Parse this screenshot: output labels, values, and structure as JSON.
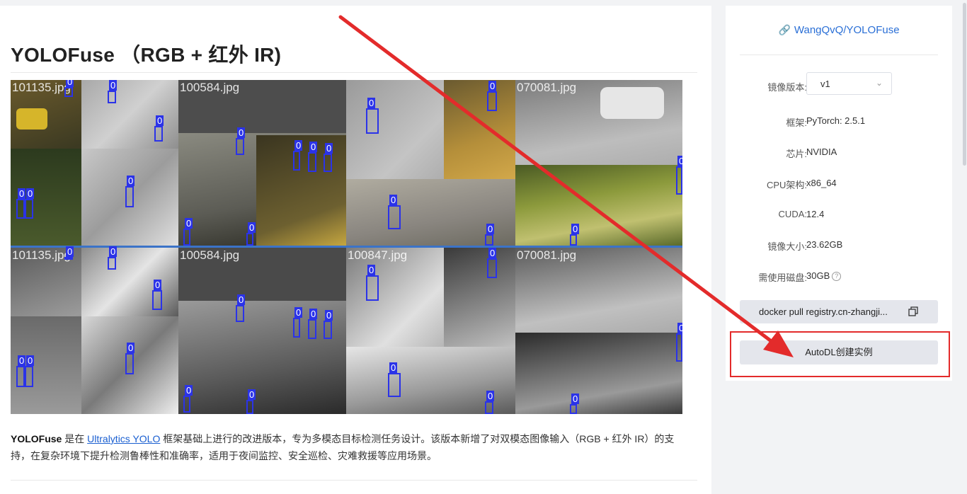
{
  "main": {
    "title": "YOLOFuse （RGB + 红外 IR)",
    "mosaic_labels": {
      "row1": [
        "101135.jpg",
        "100584.jpg",
        "",
        "070081.jpg"
      ],
      "row2": [
        "101135.jpg",
        "100584.jpg",
        "100847.jpg",
        "070081.jpg"
      ]
    },
    "detection_label": "0",
    "description": {
      "bold": "YOLOFuse",
      "pre_link": " 是在 ",
      "link_text": "Ultralytics YOLO",
      "post_link": " 框架基础上进行的改进版本，专为多模态目标检测任务设计。该版本新增了对双模态图像输入（RGB + 红外 IR）的支持，在复杂环境下提升检测鲁棒性和准确率，适用于夜间监控、安全巡检、灾难救援等应用场景。"
    }
  },
  "sidebar": {
    "repo_link": "WangQvQ/YOLOFuse",
    "link_icon": "link-icon",
    "version_label": "镜像版本:",
    "version_value": "v1",
    "specs": [
      {
        "key": "框架:",
        "value": "PyTorch: 2.5.1"
      },
      {
        "key": "芯片:",
        "value": "NVIDIA"
      },
      {
        "key": "CPU架构:",
        "value": "x86_64"
      },
      {
        "key": "CUDA:",
        "value": "12.4"
      },
      {
        "key": "镜像大小:",
        "value": "23.62GB"
      },
      {
        "key": "需使用磁盘:",
        "value": "30GB"
      }
    ],
    "help_icon": "?",
    "docker_cmd": "docker pull registry.cn-zhangji...",
    "copy_icon": "copy-icon",
    "create_button": "AutoDL创建实例"
  },
  "colors": {
    "accent_link": "#2a6fd6",
    "highlight_red": "#e32b2b",
    "bbox_blue": "#2b33e8"
  }
}
